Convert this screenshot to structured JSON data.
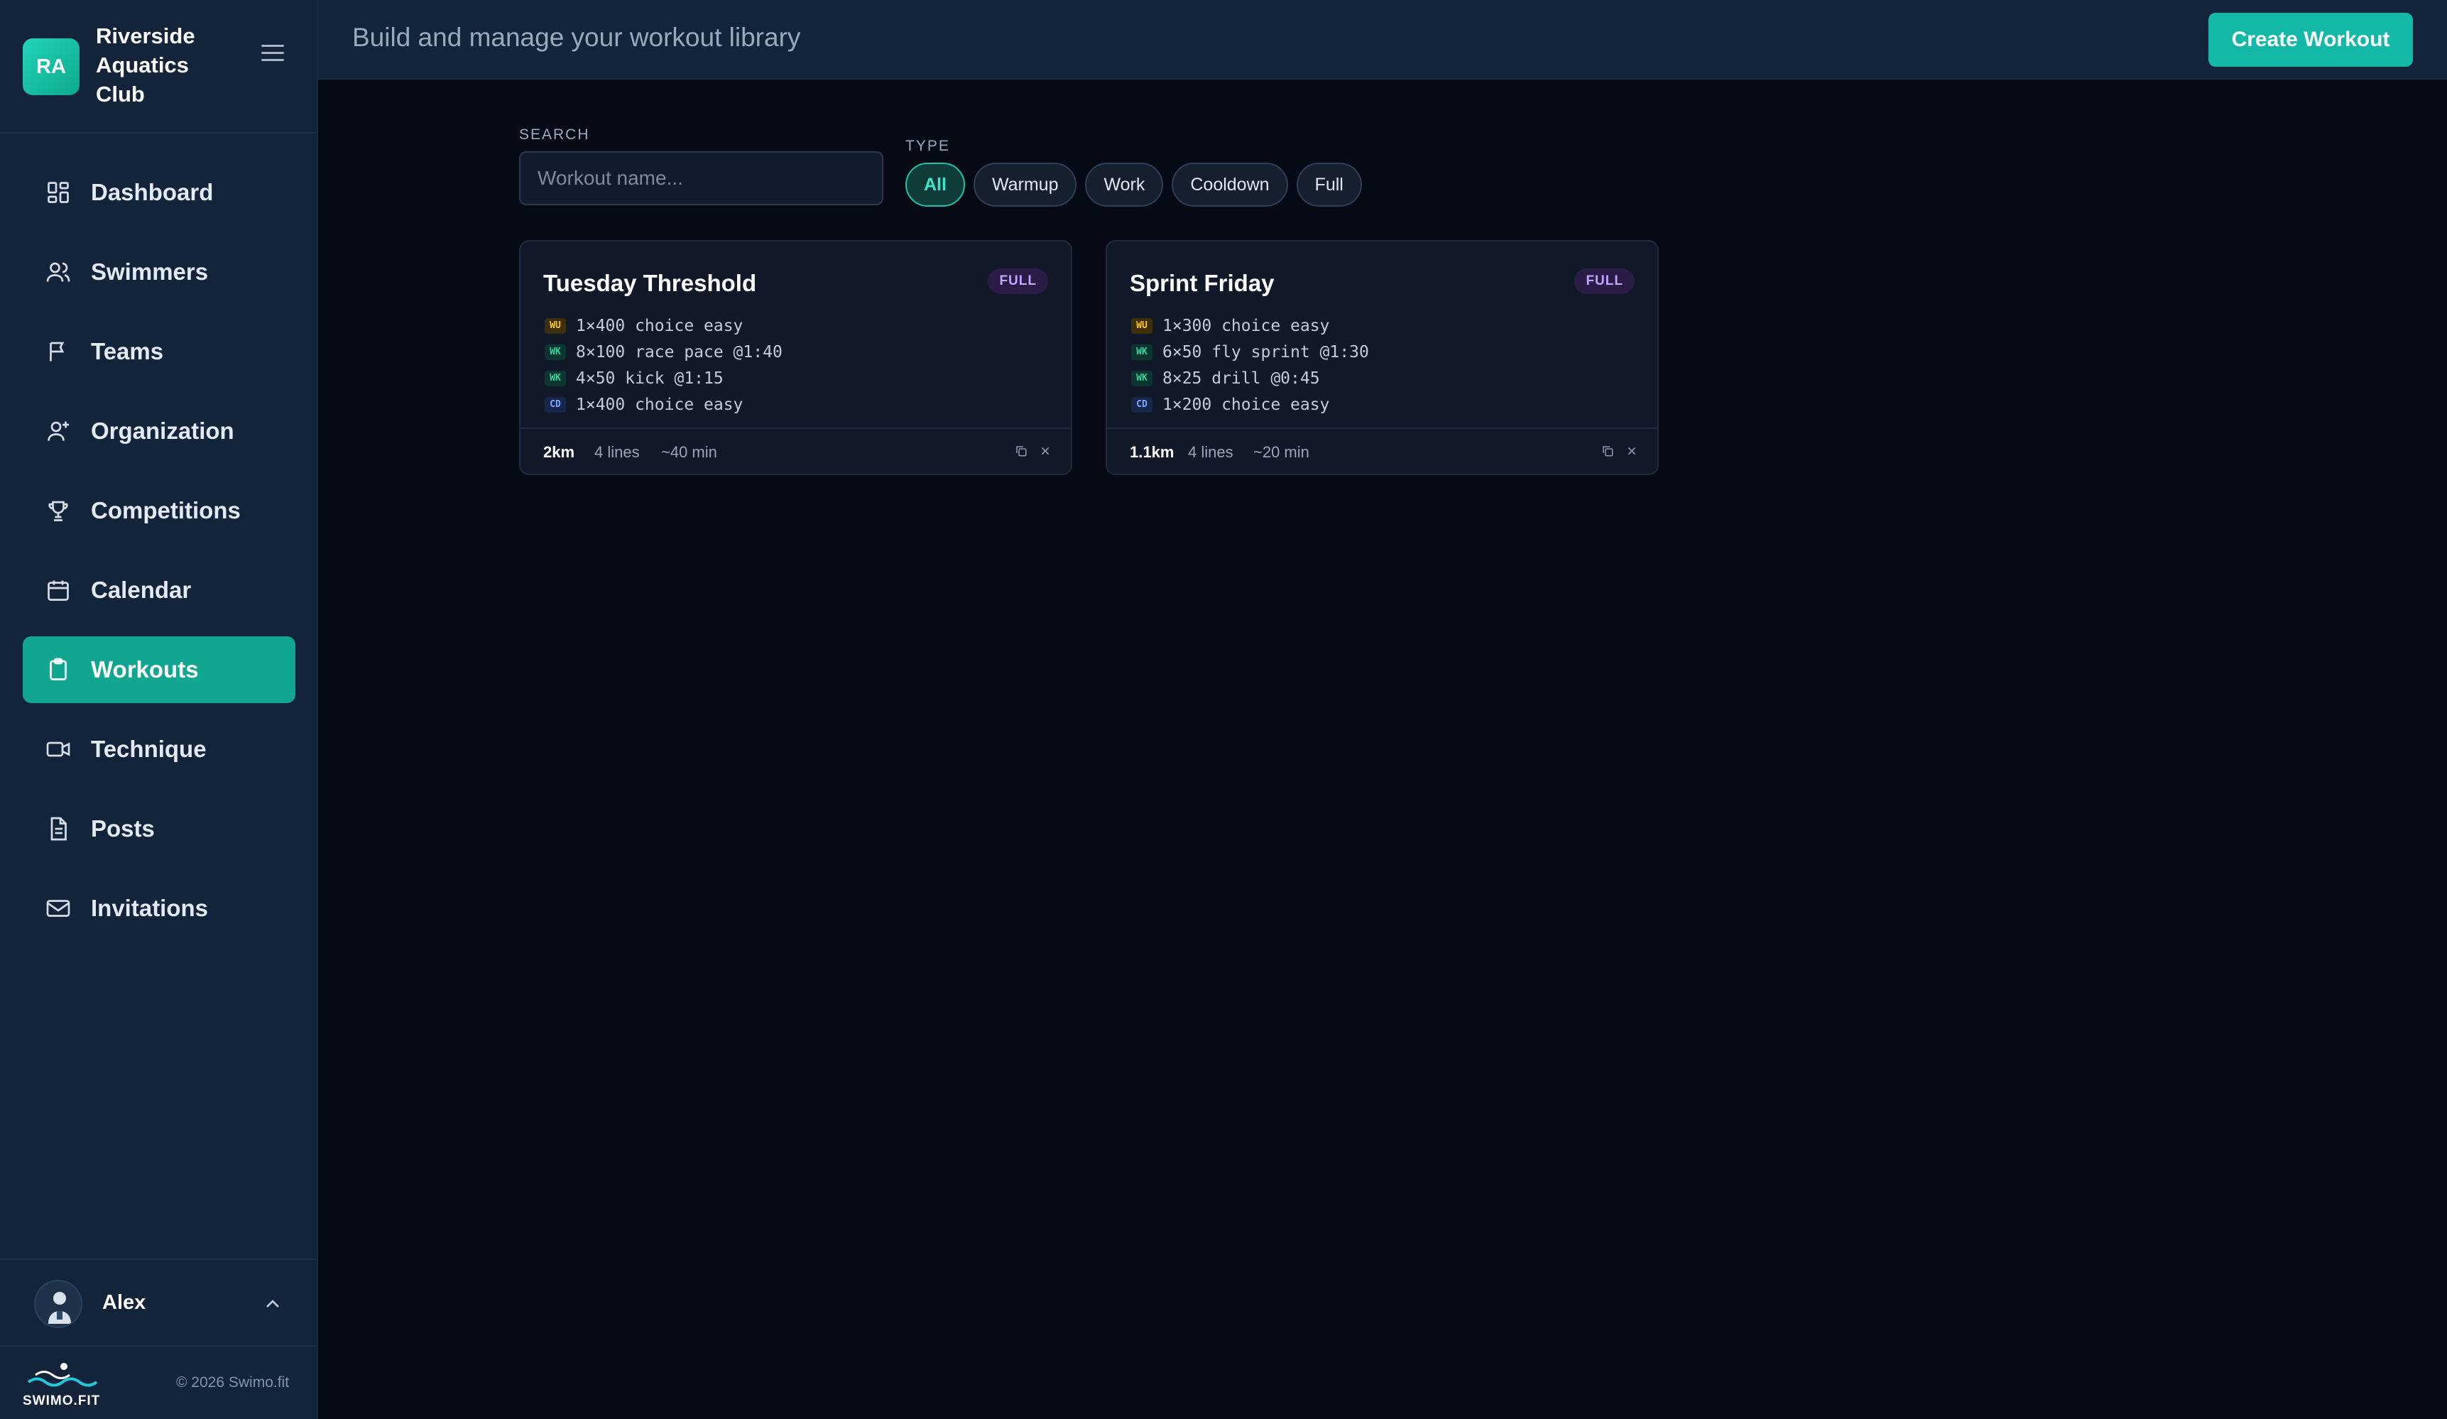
{
  "brand": {
    "initials": "RA",
    "name": "Riverside Aquatics Club"
  },
  "nav": {
    "items": [
      {
        "label": "Dashboard",
        "icon": "dashboard-icon"
      },
      {
        "label": "Swimmers",
        "icon": "users-icon"
      },
      {
        "label": "Teams",
        "icon": "flag-icon"
      },
      {
        "label": "Organization",
        "icon": "user-plus-icon"
      },
      {
        "label": "Competitions",
        "icon": "trophy-icon"
      },
      {
        "label": "Calendar",
        "icon": "calendar-icon"
      },
      {
        "label": "Workouts",
        "icon": "clipboard-icon",
        "active": true
      },
      {
        "label": "Technique",
        "icon": "video-icon"
      },
      {
        "label": "Posts",
        "icon": "document-icon"
      },
      {
        "label": "Invitations",
        "icon": "mail-icon"
      }
    ]
  },
  "user": {
    "name": "Alex"
  },
  "footer": {
    "logo_text": "SWIMO.FIT",
    "copyright": "© 2026 Swimo.fit"
  },
  "header": {
    "title": "Build and manage your workout library",
    "create_label": "Create Workout"
  },
  "filters": {
    "search_label": "SEARCH",
    "search_placeholder": "Workout name...",
    "search_value": "",
    "type_label": "TYPE",
    "types": [
      "All",
      "Warmup",
      "Work",
      "Cooldown",
      "Full"
    ],
    "active_type": "All"
  },
  "workouts": [
    {
      "title": "Tuesday Threshold",
      "badge": "FULL",
      "lines": [
        {
          "tag": "WU",
          "text": "1×400 choice easy"
        },
        {
          "tag": "WK",
          "text": "8×100 race pace @1:40"
        },
        {
          "tag": "WK",
          "text": "4×50 kick @1:15"
        },
        {
          "tag": "CD",
          "text": "1×400 choice easy"
        }
      ],
      "distance": "2km",
      "line_count": "4 lines",
      "duration": "~40 min"
    },
    {
      "title": "Sprint Friday",
      "badge": "FULL",
      "lines": [
        {
          "tag": "WU",
          "text": "1×300 choice easy"
        },
        {
          "tag": "WK",
          "text": "6×50 fly sprint @1:30"
        },
        {
          "tag": "WK",
          "text": "8×25 drill @0:45"
        },
        {
          "tag": "CD",
          "text": "1×200 choice easy"
        }
      ],
      "distance": "1.1km",
      "line_count": "4 lines",
      "duration": "~20 min"
    }
  ],
  "colors": {
    "accent": "#14b8a6",
    "sidebar": "#13233a",
    "background": "#050a15",
    "badge": "#c4a6ff"
  }
}
